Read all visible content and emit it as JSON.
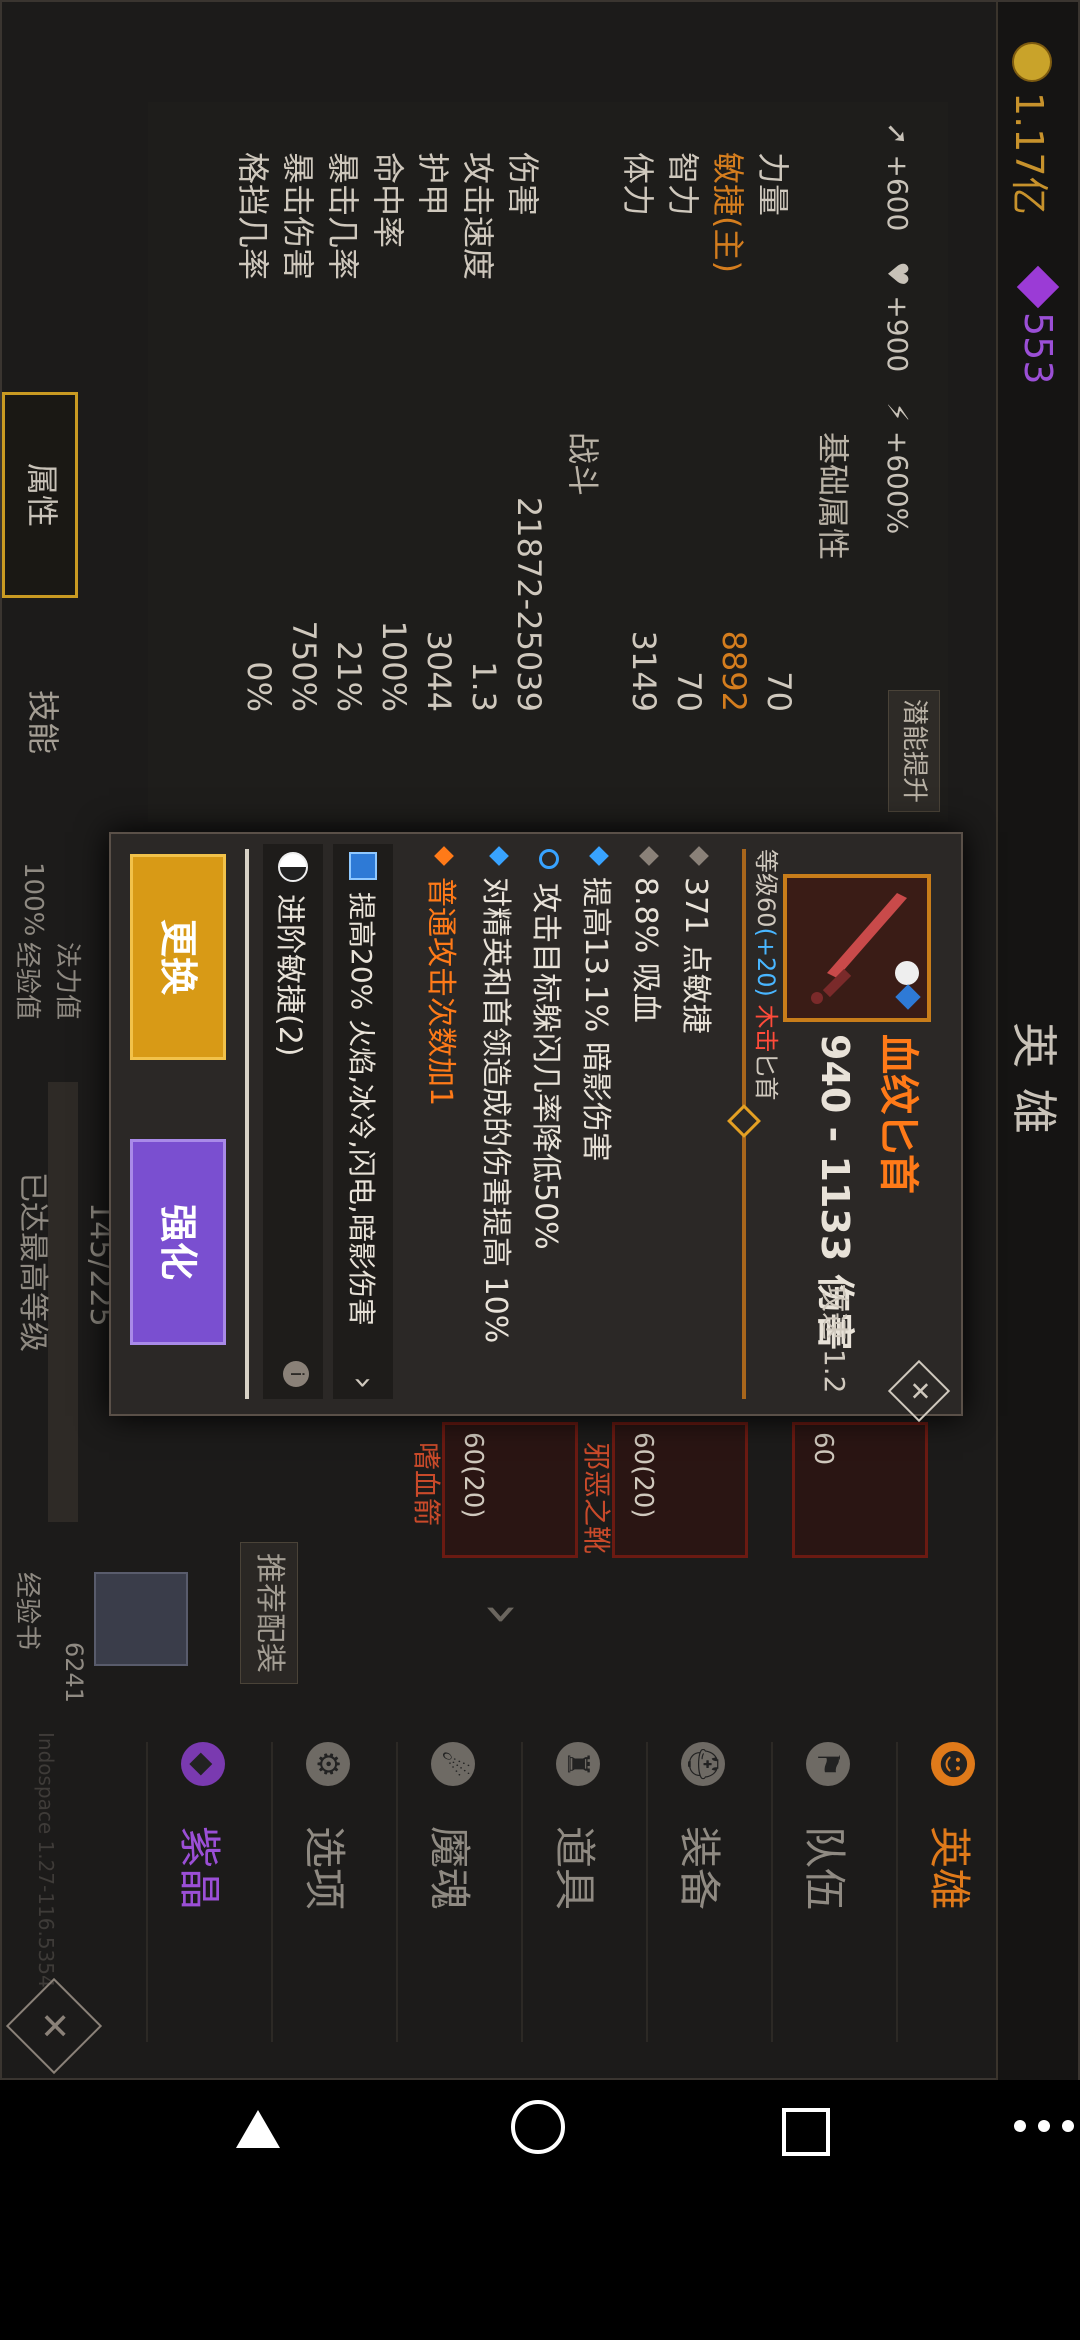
{
  "header": {
    "gold": "1.17亿",
    "gems": "553",
    "title": "英雄"
  },
  "stats": {
    "bonuses": [
      "+600",
      "+900",
      "+600%"
    ],
    "potential_button": "潜能提升",
    "base_section": "基础属性",
    "base": [
      {
        "label": "力量",
        "value": "70"
      },
      {
        "label": "敏捷(主)",
        "value": "8892"
      },
      {
        "label": "智力",
        "value": "70"
      },
      {
        "label": "体力",
        "value": "3149"
      }
    ],
    "combat_section": "战斗",
    "combat": [
      {
        "label": "伤害",
        "value": "21872-25039"
      },
      {
        "label": "攻击速度",
        "value": "1.3"
      },
      {
        "label": "护甲",
        "value": "3044"
      },
      {
        "label": "命中率",
        "value": "100%"
      },
      {
        "label": "暴击几率",
        "value": "21%"
      },
      {
        "label": "暴击伤害",
        "value": "750%"
      },
      {
        "label": "格挡几率",
        "value": "0%"
      }
    ],
    "tabs": {
      "attr": "属性",
      "skill": "技能"
    }
  },
  "sidebar": {
    "items": [
      {
        "label": "英雄"
      },
      {
        "label": "队伍"
      },
      {
        "label": "装备"
      },
      {
        "label": "道具"
      },
      {
        "label": "魔魂"
      },
      {
        "label": "选项"
      },
      {
        "label": "紫晶"
      }
    ]
  },
  "background": {
    "recommend": "推荐配装",
    "slots": [
      {
        "level": "60",
        "name": ""
      },
      {
        "level": "60(20)",
        "name": "邪恶之靴"
      },
      {
        "level": "60(20)",
        "name": "嗜血箭"
      }
    ],
    "exp_book_label": "经验书",
    "exp_book_count": "6241",
    "exp_max": "已达最高等级",
    "exp_pct": "100%",
    "exp_label": "经验值",
    "magic_label": "法力值",
    "exp_value": "145/225",
    "watermark": "Indospace 1.27-116.5354"
  },
  "popup": {
    "name": "血纹匕首",
    "damage": "940 - 1133 伤害",
    "speed": "攻速 1.2",
    "level_prefix": "等级60",
    "level_bonus": "(+20)",
    "level_tag": "木击",
    "level_type": "匕首",
    "stats": [
      "371 点敏捷",
      "8.8% 吸血",
      "提高13.1% 暗影伤害",
      "攻击目标躲闪几率降低50%",
      "对精英和首领造成的伤害提高 10%",
      "普通攻击次数加1"
    ],
    "gem_text": "提高20% 火焰,冰冷,闪电,暗影伤害",
    "yin_text": "进阶敏捷(2)",
    "btn_replace": "更换",
    "btn_upgrade": "强化"
  },
  "colors": {
    "accent": "#ff7a18",
    "gold": "#c9a32a",
    "purple": "#9b4fd6"
  }
}
